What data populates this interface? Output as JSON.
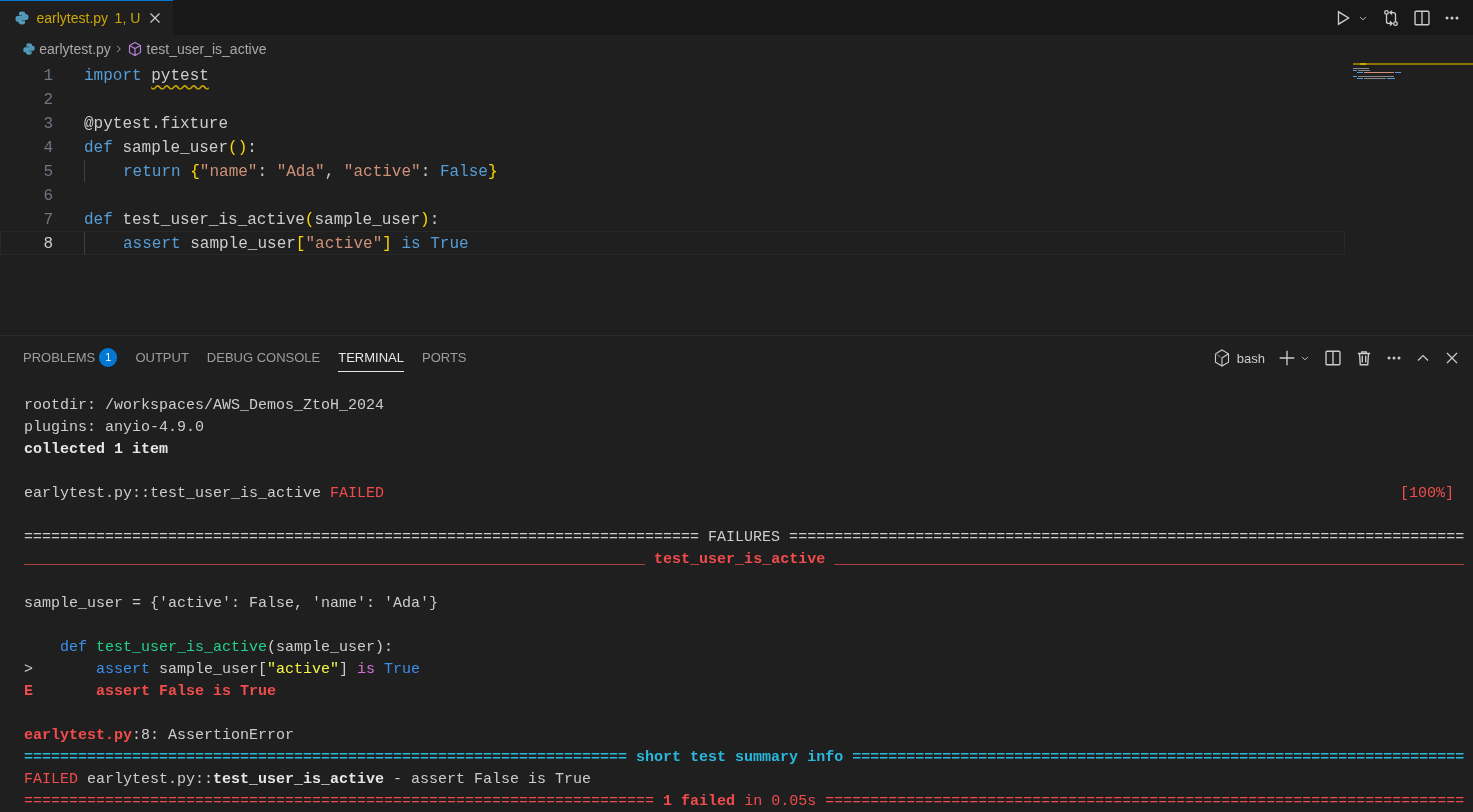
{
  "editor_tab": {
    "label": "earlytest.py",
    "status": "1, U",
    "selected": true
  },
  "breadcrumbs": [
    {
      "label": "earlytest.py",
      "kind": "file"
    },
    {
      "label": "test_user_is_active",
      "kind": "symbol"
    }
  ],
  "code_lines": [
    {
      "number": "1",
      "selected": false,
      "indented": false,
      "tokens": [
        {
          "text": "import ",
          "kind": "keyword"
        },
        {
          "text": "pytest",
          "kind": "warned"
        }
      ]
    },
    {
      "number": "2",
      "selected": false
    },
    {
      "number": "3",
      "selected": false,
      "indented": false,
      "tokens": [
        {
          "text": "@pytest.fixture",
          "kind": "plain"
        }
      ]
    },
    {
      "number": "4",
      "selected": false,
      "indented": false,
      "tokens": [
        {
          "text": "def",
          "kind": "keyword"
        },
        {
          "text": " sample_user",
          "kind": "plain"
        },
        {
          "text": "()",
          "kind": "bracket"
        },
        {
          "text": ":",
          "kind": "plain"
        }
      ]
    },
    {
      "number": "5",
      "selected": false,
      "indented": true,
      "tokens": [
        {
          "text": "return ",
          "kind": "keyword"
        },
        {
          "text": "{",
          "kind": "bracket"
        },
        {
          "text": "\"name\"",
          "kind": "string"
        },
        {
          "text": ": ",
          "kind": "plain"
        },
        {
          "text": "\"Ada\"",
          "kind": "string"
        },
        {
          "text": ", ",
          "kind": "plain"
        },
        {
          "text": "\"active\"",
          "kind": "string"
        },
        {
          "text": ": ",
          "kind": "plain"
        },
        {
          "text": "False",
          "kind": "keyword"
        },
        {
          "text": "}",
          "kind": "bracket"
        }
      ]
    },
    {
      "number": "6",
      "selected": false
    },
    {
      "number": "7",
      "selected": false,
      "indented": false,
      "tokens": [
        {
          "text": "def",
          "kind": "keyword"
        },
        {
          "text": " test_user_is_active",
          "kind": "plain"
        },
        {
          "text": "(",
          "kind": "bracket"
        },
        {
          "text": "sample_user",
          "kind": "plain"
        },
        {
          "text": ")",
          "kind": "bracket"
        },
        {
          "text": ":",
          "kind": "plain"
        }
      ]
    },
    {
      "number": "8",
      "selected": true,
      "indented": true,
      "tokens": [
        {
          "text": "assert",
          "kind": "keyword"
        },
        {
          "text": " sample_user",
          "kind": "plain"
        },
        {
          "text": "[",
          "kind": "bracket"
        },
        {
          "text": "\"active\"",
          "kind": "string"
        },
        {
          "text": "]",
          "kind": "bracket"
        },
        {
          "text": " is True",
          "kind": "keyword"
        }
      ]
    }
  ],
  "panel_tabs": [
    {
      "label": "PROBLEMS",
      "badge": "1",
      "selected": false
    },
    {
      "label": "OUTPUT",
      "selected": false
    },
    {
      "label": "DEBUG CONSOLE",
      "selected": false
    },
    {
      "label": "TERMINAL",
      "selected": true
    },
    {
      "label": "PORTS",
      "selected": false
    }
  ],
  "terminal": {
    "shell": "bash",
    "lines": [
      {
        "kind": "text",
        "segments": [
          {
            "text": "rootdir: /workspaces/AWS_Demos_ZtoH_2024",
            "kind": "plain"
          }
        ]
      },
      {
        "kind": "text",
        "segments": [
          {
            "text": "plugins: anyio-4.9.0",
            "kind": "plain"
          }
        ]
      },
      {
        "kind": "text",
        "segments": [
          {
            "text": "collected 1 item",
            "kind": "bold"
          }
        ]
      },
      {
        "kind": "blank"
      },
      {
        "kind": "text",
        "segments": [
          {
            "text": "earlytest.py::test_user_is_active ",
            "kind": "plain"
          },
          {
            "text": "FAILED",
            "kind": "red"
          }
        ],
        "suffix": {
          "text": "[100%]",
          "kind": "red"
        }
      },
      {
        "kind": "blank"
      },
      {
        "kind": "text",
        "segments": [
          {
            "text": "=========================================================================== FAILURES ===========================================================================",
            "kind": "plain"
          }
        ]
      },
      {
        "kind": "text",
        "segments": [
          {
            "text": "_____________________________________________________________________ ",
            "kind": "red"
          },
          {
            "text": "test_user_is_active",
            "kind": "red-bold"
          },
          {
            "text": " ______________________________________________________________________",
            "kind": "red"
          }
        ]
      },
      {
        "kind": "blank"
      },
      {
        "kind": "text",
        "segments": [
          {
            "text": "sample_user = {'active': False, 'name': 'Ada'}",
            "kind": "plain"
          }
        ]
      },
      {
        "kind": "blank"
      },
      {
        "kind": "text",
        "segments": [
          {
            "text": "    def ",
            "kind": "blue"
          },
          {
            "text": "test_user_is_active",
            "kind": "green"
          },
          {
            "text": "(sample_user):",
            "kind": "plain"
          }
        ]
      },
      {
        "kind": "text",
        "segments": [
          {
            "text": ">       ",
            "kind": "plain"
          },
          {
            "text": "assert",
            "kind": "blue"
          },
          {
            "text": " sample_user[",
            "kind": "plain"
          },
          {
            "text": "\"active\"",
            "kind": "yellow"
          },
          {
            "text": "] ",
            "kind": "plain"
          },
          {
            "text": "is ",
            "kind": "magenta"
          },
          {
            "text": "True",
            "kind": "blue"
          }
        ]
      },
      {
        "kind": "text",
        "segments": [
          {
            "text": "E       assert False is True",
            "kind": "red-bold"
          }
        ]
      },
      {
        "kind": "blank"
      },
      {
        "kind": "text",
        "segments": [
          {
            "text": "earlytest.py",
            "kind": "red-bold"
          },
          {
            "text": ":8: AssertionError",
            "kind": "plain"
          }
        ]
      },
      {
        "kind": "text",
        "segments": [
          {
            "text": "=================================================================== short test summary info ====================================================================",
            "kind": "cyan-bold"
          }
        ]
      },
      {
        "kind": "text",
        "segments": [
          {
            "text": "FAILED",
            "kind": "red"
          },
          {
            "text": " earlytest.py::",
            "kind": "plain"
          },
          {
            "text": "test_user_is_active",
            "kind": "bold"
          },
          {
            "text": " - assert False is True",
            "kind": "plain"
          }
        ]
      },
      {
        "kind": "text",
        "segments": [
          {
            "text": "====================================================================== ",
            "kind": "red"
          },
          {
            "text": "1 failed",
            "kind": "red-bold"
          },
          {
            "text": " in 0.05s =======================================================================",
            "kind": "red"
          }
        ]
      }
    ]
  }
}
